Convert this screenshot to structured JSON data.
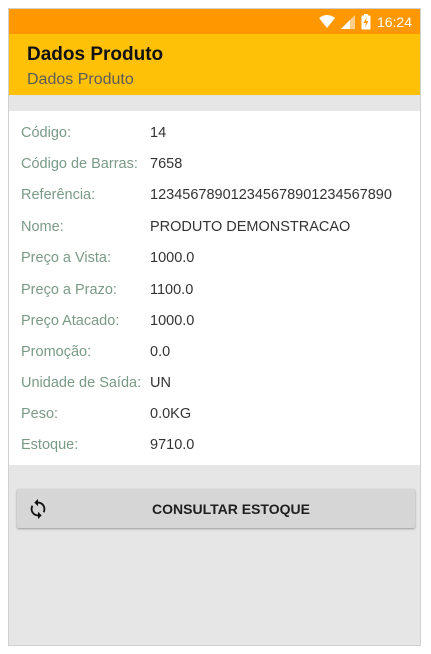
{
  "status_bar": {
    "time": "16:24",
    "icons": [
      "wifi-icon",
      "signal-icon",
      "battery-charging-icon"
    ]
  },
  "app_bar": {
    "title": "Dados Produto",
    "subtitle": "Dados Produto",
    "color": "#ffc107"
  },
  "status_bar_color": "#ff9800",
  "product": {
    "fields": [
      {
        "label": "Código:",
        "value": "14"
      },
      {
        "label": "Código de Barras:",
        "value": "7658"
      },
      {
        "label": "Referência:",
        "value": "123456789012345678901234567890"
      },
      {
        "label": "Nome:",
        "value": "PRODUTO DEMONSTRACAO"
      },
      {
        "label": "Preço a Vista:",
        "value": "1000.0"
      },
      {
        "label": "Preço a Prazo:",
        "value": "1100.0"
      },
      {
        "label": "Preço Atacado:",
        "value": "1000.0"
      },
      {
        "label": "Promoção:",
        "value": "0.0"
      },
      {
        "label": "Unidade de Saída:",
        "value": "UN"
      },
      {
        "label": "Peso:",
        "value": "0.0KG"
      },
      {
        "label": "Estoque:",
        "value": "9710.0"
      }
    ]
  },
  "actions": {
    "consult_stock_label": "CONSULTAR ESTOQUE",
    "consult_stock_icon": "refresh-icon"
  }
}
